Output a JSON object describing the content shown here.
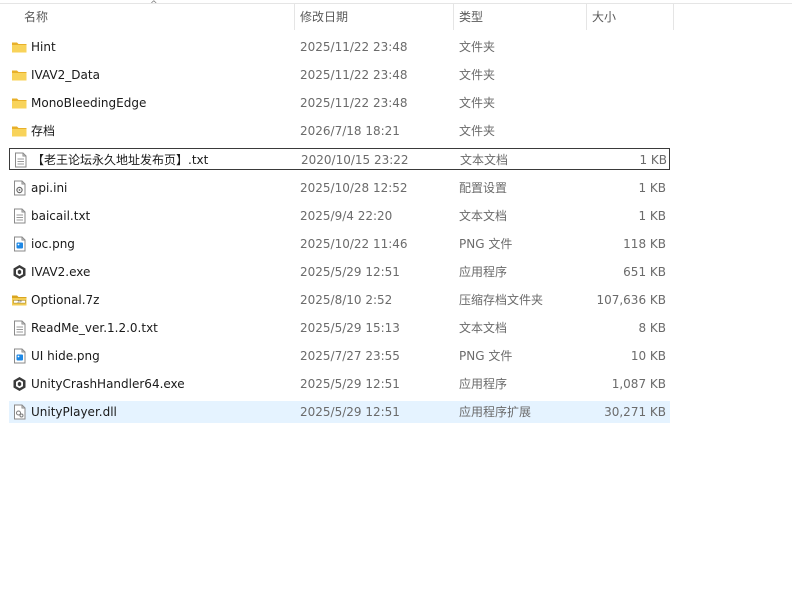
{
  "columns": {
    "name": "名称",
    "date": "修改日期",
    "type": "类型",
    "size": "大小"
  },
  "sort_indicator": "^",
  "files": [
    {
      "name": "Hint",
      "date": "2025/11/22 23:48",
      "type": "文件夹",
      "size": "",
      "icon": "folder-icon"
    },
    {
      "name": "IVAV2_Data",
      "date": "2025/11/22 23:48",
      "type": "文件夹",
      "size": "",
      "icon": "folder-icon"
    },
    {
      "name": "MonoBleedingEdge",
      "date": "2025/11/22 23:48",
      "type": "文件夹",
      "size": "",
      "icon": "folder-icon"
    },
    {
      "name": "存档",
      "date": "2026/7/18 18:21",
      "type": "文件夹",
      "size": "",
      "icon": "folder-icon"
    },
    {
      "name": "【老王论坛永久地址发布页】.txt",
      "date": "2020/10/15 23:22",
      "type": "文本文档",
      "size": "1 KB",
      "icon": "text-file-icon",
      "state": "focused"
    },
    {
      "name": "api.ini",
      "date": "2025/10/28 12:52",
      "type": "配置设置",
      "size": "1 KB",
      "icon": "config-file-icon"
    },
    {
      "name": "baicail.txt",
      "date": "2025/9/4 22:20",
      "type": "文本文档",
      "size": "1 KB",
      "icon": "text-file-icon"
    },
    {
      "name": "ioc.png",
      "date": "2025/10/22 11:46",
      "type": "PNG 文件",
      "size": "118 KB",
      "icon": "image-file-icon"
    },
    {
      "name": "IVAV2.exe",
      "date": "2025/5/29 12:51",
      "type": "应用程序",
      "size": "651 KB",
      "icon": "unity-app-icon"
    },
    {
      "name": "Optional.7z",
      "date": "2025/8/10 2:52",
      "type": "压缩存档文件夹",
      "size": "107,636 KB",
      "icon": "archive-icon"
    },
    {
      "name": "ReadMe_ver.1.2.0.txt",
      "date": "2025/5/29 15:13",
      "type": "文本文档",
      "size": "8 KB",
      "icon": "text-file-icon"
    },
    {
      "name": "UI hide.png",
      "date": "2025/7/27 23:55",
      "type": "PNG 文件",
      "size": "10 KB",
      "icon": "image-file-icon"
    },
    {
      "name": "UnityCrashHandler64.exe",
      "date": "2025/5/29 12:51",
      "type": "应用程序",
      "size": "1,087 KB",
      "icon": "unity-app-icon"
    },
    {
      "name": "UnityPlayer.dll",
      "date": "2025/5/29 12:51",
      "type": "应用程序扩展",
      "size": "30,271 KB",
      "icon": "dll-file-icon",
      "state": "selected"
    }
  ],
  "colors": {
    "selection": "#e5f3ff",
    "folder": "#f4c542",
    "text_secondary": "#6b6b6b"
  }
}
